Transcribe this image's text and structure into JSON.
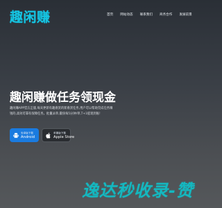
{
  "header": {
    "logo_text": "趣闲赚",
    "nav": [
      "首页",
      "网站动态",
      "联系我们",
      "商务合作",
      "发展前景"
    ]
  },
  "hero": {
    "title": "趣闲赚做任务领现金",
    "description": "趣闲赚APP官方正版,每天更新有趣悬赏的新悬赏任务,用户可以帮助完成任务赚钱的,高效可靠有保障任务。批量派单,最快每5分钟/单,T+1提现到账!"
  },
  "download": {
    "android": {
      "small": "安卓版下载",
      "label": "Android"
    },
    "ios": {
      "small": "苹果版下载",
      "label": "Apple Store"
    }
  },
  "watermark": {
    "text": "逸达秒收录-赞"
  },
  "colors": {
    "brand": "#16c3e0",
    "android_button": "#1a7be0",
    "watermark": "#14b8c0"
  }
}
